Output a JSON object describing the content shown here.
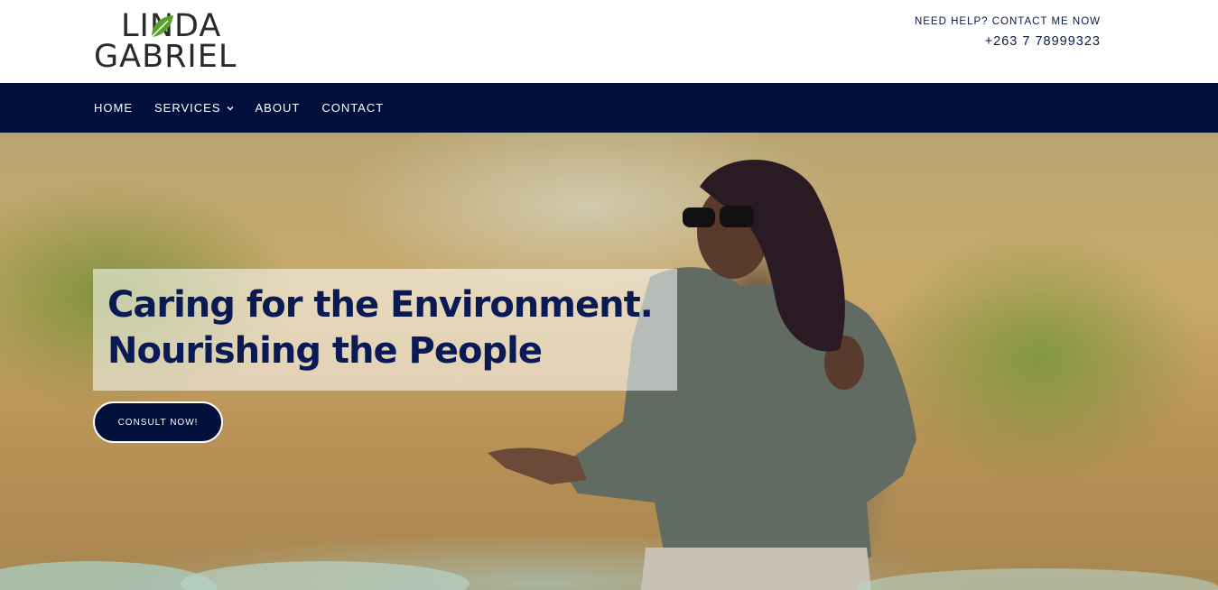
{
  "logo": {
    "line1": "LINDA",
    "line2": "GABRIEL"
  },
  "help": {
    "label": "NEED HELP? CONTACT ME NOW",
    "phone": "+263 7 78999323"
  },
  "nav": {
    "items": [
      {
        "label": "HOME"
      },
      {
        "label": "SERVICES"
      },
      {
        "label": "ABOUT"
      },
      {
        "label": "CONTACT"
      }
    ]
  },
  "hero": {
    "headline_line1": "Caring for the Environment.",
    "headline_line2": "Nourishing the People",
    "cta_label": "CONSULT NOW!"
  },
  "colors": {
    "navy": "#00103a",
    "headline": "#0a1a55",
    "leaf": "#5aa02c"
  }
}
